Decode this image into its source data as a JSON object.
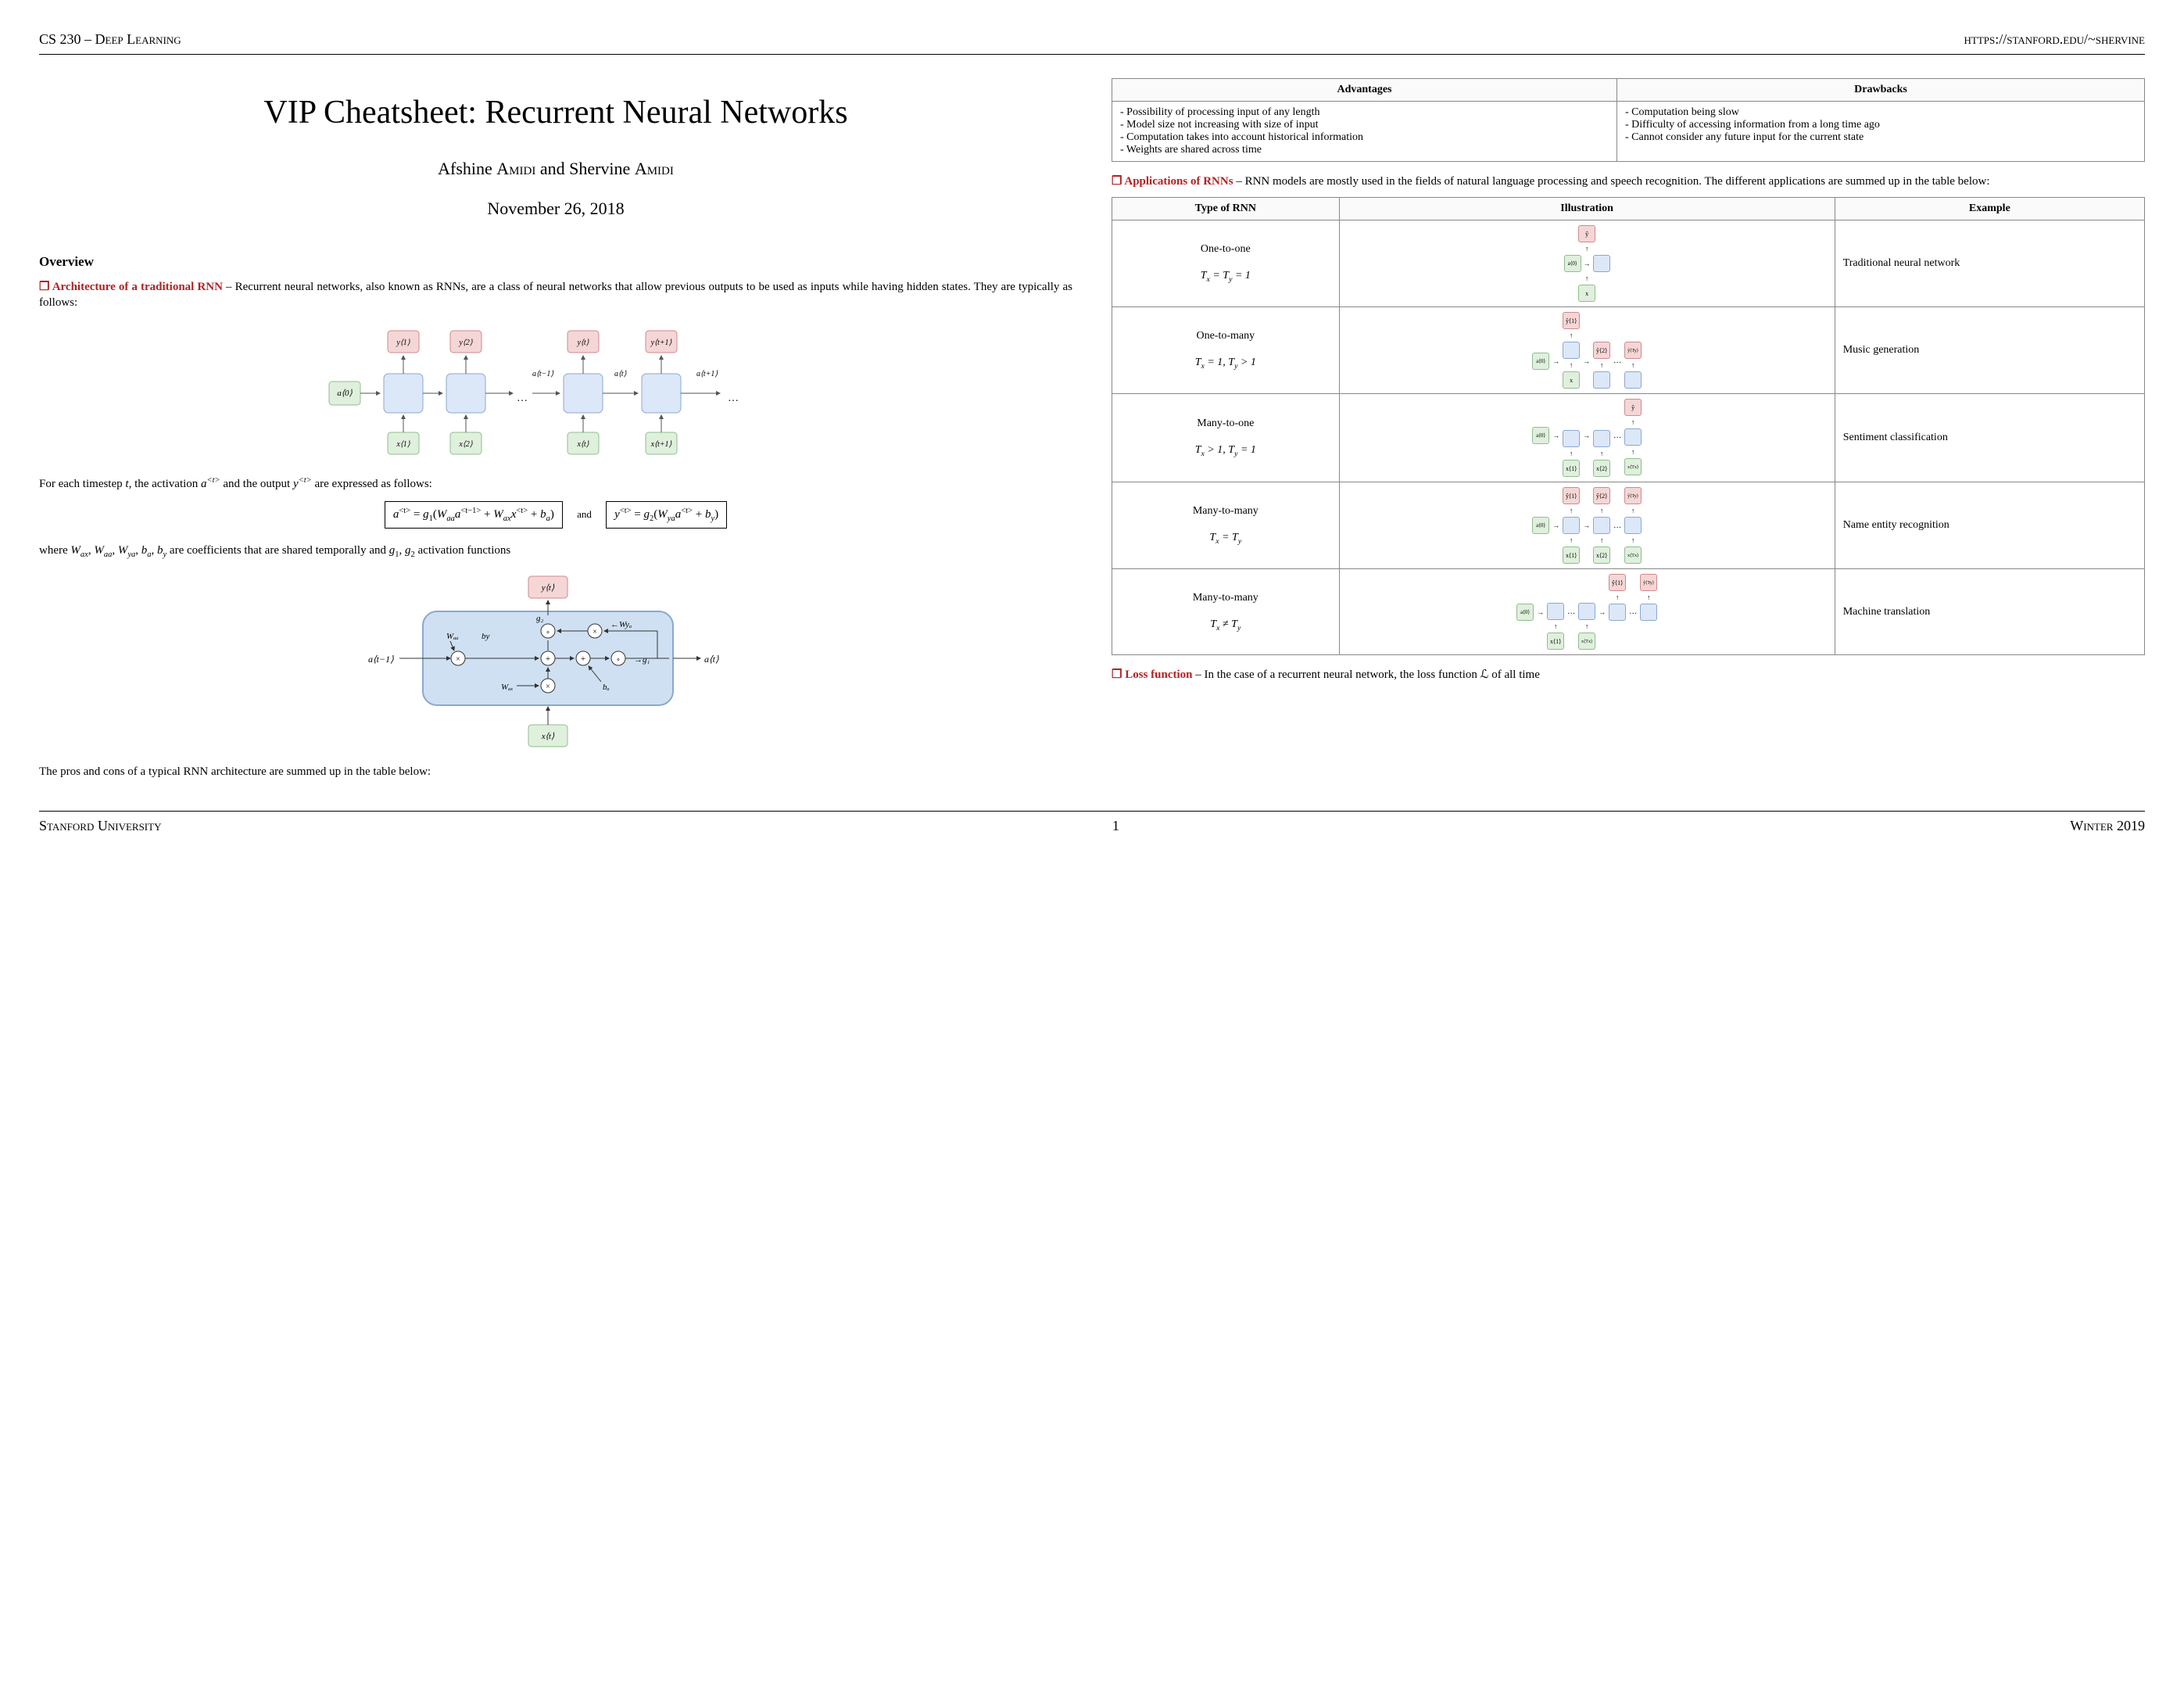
{
  "header": {
    "left": "CS 230 – Deep Learning",
    "right": "https://stanford.edu/~shervine"
  },
  "title": "VIP Cheatsheet: Recurrent Neural Networks",
  "authors": "Afshine Amidi and Shervine Amidi",
  "date": "November 26, 2018",
  "overview_h": "Overview",
  "arch_label": "Architecture of a traditional RNN",
  "arch_text": " – Recurrent neural networks, also known as RNNs, are a class of neural networks that allow previous outputs to be used as inputs while having hidden states. They are typically as follows:",
  "timestep_text": "For each timestep t, the activation a<t> and the output y<t> are expressed as follows:",
  "eq1": "a<t> = g₁(Wₐₐa<t−1> + Wₐₓx<t> + bₐ)",
  "eq_and": "and",
  "eq2": "y<t> = g₂(Wyₐa<t> + by)",
  "where_text": "where Wₐₓ, Wₐₐ, Wyₐ, bₐ, by are coefficients that are shared temporally and g₁, g₂ activation functions",
  "proscons_intro": "The pros and cons of a typical RNN architecture are summed up in the table below:",
  "adv_table": {
    "h1": "Advantages",
    "h2": "Drawbacks",
    "adv": "- Possibility of processing input of any length\n- Model size not increasing with size of input\n- Computation takes into account historical information\n- Weights are shared across time",
    "drw": "- Computation being slow\n- Difficulty of accessing information from a long time ago\n- Cannot consider any future input for the current state"
  },
  "apps_label": "Applications of RNNs",
  "apps_text": " – RNN models are mostly used in the fields of natural language processing and speech recognition. The different applications are summed up in the table below:",
  "apps_table": {
    "h1": "Type of RNN",
    "h2": "Illustration",
    "h3": "Example",
    "rows": [
      {
        "type_line1": "One-to-one",
        "type_line2": "Tₓ = Ty = 1",
        "example": "Traditional neural network"
      },
      {
        "type_line1": "One-to-many",
        "type_line2": "Tₓ = 1, Ty > 1",
        "example": "Music generation"
      },
      {
        "type_line1": "Many-to-one",
        "type_line2": "Tₓ > 1, Ty = 1",
        "example": "Sentiment classification"
      },
      {
        "type_line1": "Many-to-many",
        "type_line2": "Tₓ = Ty",
        "example": "Name entity recognition"
      },
      {
        "type_line1": "Many-to-many",
        "type_line2": "Tₓ ≠ Ty",
        "example": "Machine translation"
      }
    ]
  },
  "loss_label": "Loss function",
  "loss_text": " – In the case of a recurrent neural network, the loss function ℒ of all time",
  "footer": {
    "left": "Stanford University",
    "page": "1",
    "right": "Winter 2019"
  },
  "diag_labels": {
    "y1": "y<1>",
    "y2": "y<2>",
    "yt": "y<t>",
    "ytp1": "y<t+1>",
    "x1": "x<1>",
    "x2": "x<2>",
    "xt": "x<t>",
    "xtp1": "x<t+1>",
    "a0": "a<0>",
    "atm1": "a<t−1>",
    "at": "a<t>",
    "atp1": "a<t+1>",
    "Waa": "Wₐₐ",
    "Wax": "Wₐₓ",
    "Wya": "Wyₐ",
    "ba": "bₐ",
    "by": "by",
    "g1": "g₁",
    "g2": "g₂",
    "yhat": "ŷ",
    "x": "x",
    "dots": "…",
    "yTy": "ŷ<Ty>",
    "xTx": "x<Tx>"
  }
}
